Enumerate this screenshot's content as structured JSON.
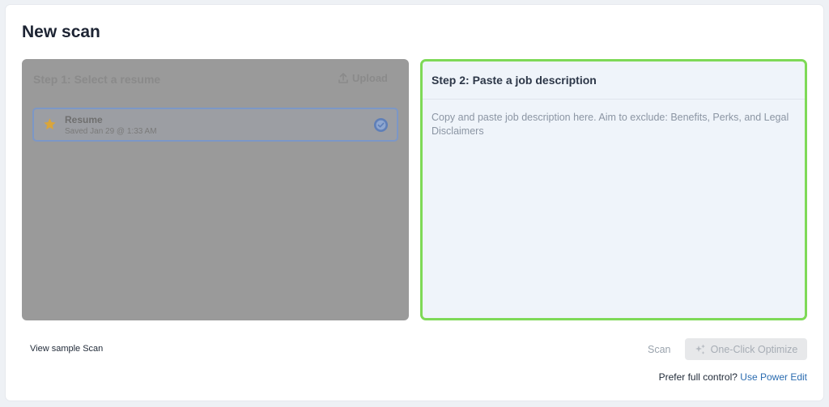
{
  "page": {
    "title": "New scan"
  },
  "step1": {
    "title": "Step 1: Select a resume",
    "upload_label": "Upload",
    "resume": {
      "name": "Resume",
      "saved": "Saved Jan 29 @ 1:33 AM",
      "selected": true
    }
  },
  "step2": {
    "title": "Step 2: Paste a job description",
    "placeholder": "Copy and paste job description here. Aim to exclude: Benefits, Perks, and Legal Disclaimers",
    "value": ""
  },
  "footer": {
    "sample_link": "View sample Scan",
    "scan_label": "Scan",
    "optimize_label": "One-Click Optimize",
    "prefer_text": "Prefer full control?",
    "power_edit_label": "Use Power Edit"
  },
  "icons": {
    "upload": "upload-icon",
    "star": "star-icon",
    "check": "check-circle-icon",
    "sparkle": "sparkle-icon"
  },
  "colors": {
    "active_border": "#7ed957",
    "link": "#2b6cb0",
    "selected_border": "#7c97c6"
  }
}
